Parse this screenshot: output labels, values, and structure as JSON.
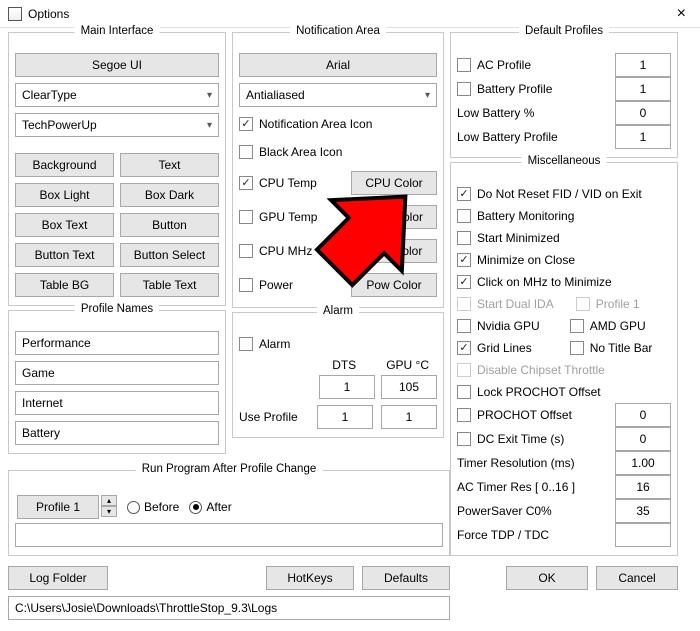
{
  "window": {
    "title": "Options",
    "close": "×"
  },
  "main_interface": {
    "title": "Main Interface",
    "font_button": "Segoe UI",
    "render_combo": "ClearType",
    "theme_combo": "TechPowerUp",
    "buttons": {
      "background": "Background",
      "text": "Text",
      "box_light": "Box Light",
      "box_dark": "Box Dark",
      "box_text": "Box Text",
      "button": "Button",
      "button_text": "Button Text",
      "button_select": "Button Select",
      "table_bg": "Table BG",
      "table_text": "Table Text"
    }
  },
  "profile_names": {
    "title": "Profile Names",
    "values": [
      "Performance",
      "Game",
      "Internet",
      "Battery"
    ]
  },
  "notification": {
    "title": "Notification Area",
    "font_button": "Arial",
    "aa_combo": "Antialiased",
    "checks": {
      "icon": {
        "label": "Notification Area Icon",
        "checked": true
      },
      "black": {
        "label": "Black Area Icon",
        "checked": false
      },
      "cpu_temp": {
        "label": "CPU Temp",
        "checked": true
      },
      "gpu_temp": {
        "label": "GPU Temp",
        "checked": false
      },
      "cpu_mhz": {
        "label": "CPU MHz",
        "checked": false
      },
      "power": {
        "label": "Power",
        "checked": false
      }
    },
    "color_buttons": {
      "cpu": "CPU Color",
      "gpu": "GPU Color",
      "mhz": "MHz Color",
      "pow": "Pow Color"
    }
  },
  "alarm": {
    "title": "Alarm",
    "checkbox": "Alarm",
    "dts_label": "DTS",
    "gpu_label": "GPU °C",
    "dts_val": "1",
    "gpu_val": "105",
    "use_profile": "Use Profile",
    "up1": "1",
    "up2": "1"
  },
  "run": {
    "title": "Run Program After Profile Change",
    "profile_btn": "Profile 1",
    "before": "Before",
    "after": "After",
    "log_folder": "Log Folder",
    "hotkeys": "HotKeys",
    "defaults": "Defaults",
    "path": "C:\\Users\\Josie\\Downloads\\ThrottleStop_9.3\\Logs"
  },
  "defaults": {
    "title": "Default Profiles",
    "ac": {
      "label": "AC Profile",
      "val": "1"
    },
    "bat": {
      "label": "Battery Profile",
      "val": "1"
    },
    "lowp": {
      "label": "Low Battery %",
      "val": "0"
    },
    "lowprof": {
      "label": "Low Battery Profile",
      "val": "1"
    }
  },
  "misc": {
    "title": "Miscellaneous",
    "items": [
      {
        "key": "noreset",
        "label": "Do Not Reset FID / VID on Exit",
        "checked": true
      },
      {
        "key": "batmon",
        "label": "Battery Monitoring",
        "checked": false
      },
      {
        "key": "startmin",
        "label": "Start Minimized",
        "checked": false
      },
      {
        "key": "minclose",
        "label": "Minimize on Close",
        "checked": true
      },
      {
        "key": "clickmhz",
        "label": "Click on MHz to Minimize",
        "checked": true
      }
    ],
    "dual": {
      "a": "Start Dual IDA",
      "b": "Profile 1"
    },
    "gpu": {
      "nvidia": "Nvidia GPU",
      "amd": "AMD GPU"
    },
    "grid": {
      "grid": "Grid Lines",
      "notitle": "No Title Bar",
      "grid_checked": true
    },
    "chipset": "Disable Chipset Throttle",
    "lock": "Lock PROCHOT Offset",
    "rows": [
      {
        "label": "PROCHOT Offset",
        "val": "0",
        "chk": true
      },
      {
        "label": "DC Exit Time (s)",
        "val": "0",
        "chk": true
      },
      {
        "label": "Timer Resolution (ms)",
        "val": "1.00"
      },
      {
        "label": "AC Timer Res [ 0..16 ]",
        "val": "16"
      },
      {
        "label": "PowerSaver C0%",
        "val": "35"
      },
      {
        "label": "Force TDP / TDC",
        "val": ""
      }
    ]
  },
  "footer": {
    "ok": "OK",
    "cancel": "Cancel"
  }
}
